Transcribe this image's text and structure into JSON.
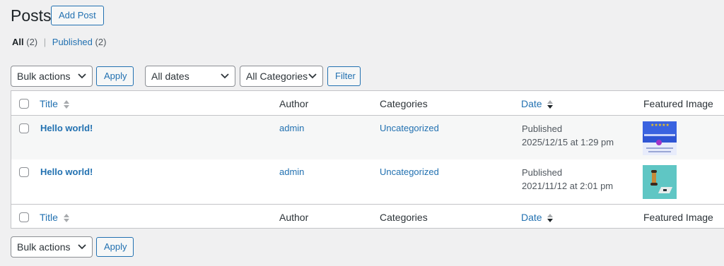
{
  "header": {
    "title": "Posts",
    "add_button": "Add Post"
  },
  "filters_links": {
    "all_label": "All",
    "all_count": "(2)",
    "separator": "|",
    "published_label": "Published",
    "published_count": "(2)"
  },
  "tablenav_top": {
    "bulk_select": "Bulk actions",
    "apply": "Apply",
    "dates_select": "All dates",
    "categories_select": "All Categories",
    "filter": "Filter"
  },
  "columns": {
    "title": "Title",
    "author": "Author",
    "categories": "Categories",
    "date": "Date",
    "featured_image": "Featured Image"
  },
  "rows": [
    {
      "title": "Hello world!",
      "author": "admin",
      "category": "Uncategorized",
      "status": "Published",
      "date": "2025/12/15 at 1:29 pm",
      "thumb_text": "★★★★★"
    },
    {
      "title": "Hello world!",
      "author": "admin",
      "category": "Uncategorized",
      "status": "Published",
      "date": "2021/11/12 at 2:01 pm"
    }
  ],
  "tablenav_bottom": {
    "bulk_select": "Bulk actions",
    "apply": "Apply"
  },
  "colors": {
    "link": "#2271b1",
    "background": "#f0f0f1",
    "border": "#c3c4c7",
    "row_alt": "#f6f7f7"
  }
}
